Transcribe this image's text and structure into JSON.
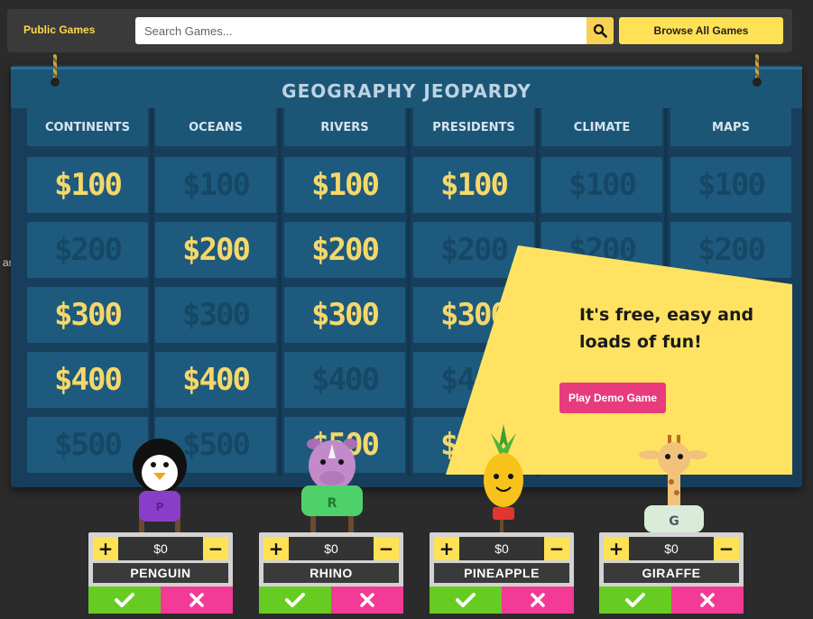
{
  "header": {
    "public_games": "Public Games",
    "search_placeholder": "Search Games...",
    "browse_label": "Browse All Games"
  },
  "side_text": "anc",
  "board": {
    "title": "GEOGRAPHY JEOPARDY",
    "categories": [
      "CONTINENTS",
      "OCEANS",
      "RIVERS",
      "PRESIDENTS",
      "CLIMATE",
      "MAPS"
    ],
    "rows": [
      {
        "value": "$100",
        "available": [
          true,
          false,
          true,
          true,
          false,
          false
        ]
      },
      {
        "value": "$200",
        "available": [
          false,
          true,
          true,
          false,
          false,
          false
        ]
      },
      {
        "value": "$300",
        "available": [
          true,
          false,
          true,
          true,
          false,
          false
        ]
      },
      {
        "value": "$400",
        "available": [
          true,
          true,
          false,
          false,
          false,
          false
        ]
      },
      {
        "value": "$500",
        "available": [
          false,
          false,
          true,
          true,
          false,
          false
        ]
      }
    ]
  },
  "promo": {
    "text": "It's free, easy and loads of fun!",
    "button": "Play Demo Game"
  },
  "players": [
    {
      "name": "PENGUIN",
      "score": "$0",
      "letter": "P"
    },
    {
      "name": "RHINO",
      "score": "$0",
      "letter": "R"
    },
    {
      "name": "PINEAPPLE",
      "score": "$0",
      "letter": ""
    },
    {
      "name": "GIRAFFE",
      "score": "$0",
      "letter": "G"
    }
  ],
  "colors": {
    "accent_yellow": "#ffe156",
    "board_bg": "#173f5c",
    "cell_bg": "#1d5a7e",
    "cell_text_on": "#f5d76a",
    "promo_bg": "#ffe261",
    "demo_button": "#e83b7e",
    "correct_green": "#66cc22",
    "wrong_pink": "#f23a96"
  }
}
